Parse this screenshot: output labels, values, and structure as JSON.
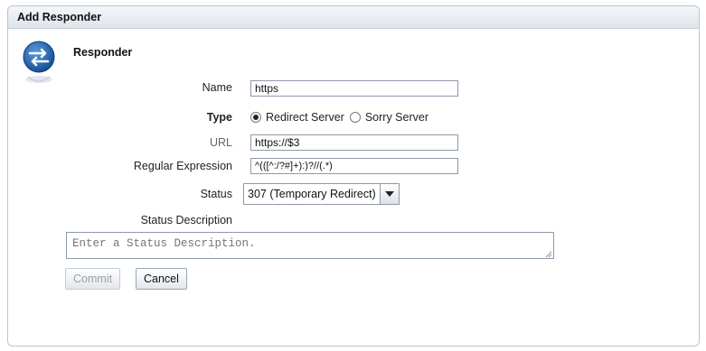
{
  "dialog": {
    "title": "Add Responder"
  },
  "section": {
    "title": "Responder",
    "icon": "responder-icon"
  },
  "form": {
    "name": {
      "label": "Name",
      "value": "https"
    },
    "type": {
      "label": "Type",
      "options": [
        {
          "label": "Redirect Server",
          "selected": true
        },
        {
          "label": "Sorry Server",
          "selected": false
        }
      ]
    },
    "url": {
      "label": "URL",
      "value": "https://$3"
    },
    "regex": {
      "label": "Regular Expression",
      "value": "^(([^:/?#]+):)?//(.*)"
    },
    "status": {
      "label": "Status",
      "value": "307 (Temporary Redirect)"
    },
    "status_description": {
      "label": "Status Description",
      "placeholder": "Enter a Status Description."
    }
  },
  "buttons": {
    "commit": "Commit",
    "cancel": "Cancel"
  },
  "colors": {
    "icon_blue": "#1f5fa8",
    "title_bar": "#dfe4ea",
    "border": "#8d99a8"
  }
}
